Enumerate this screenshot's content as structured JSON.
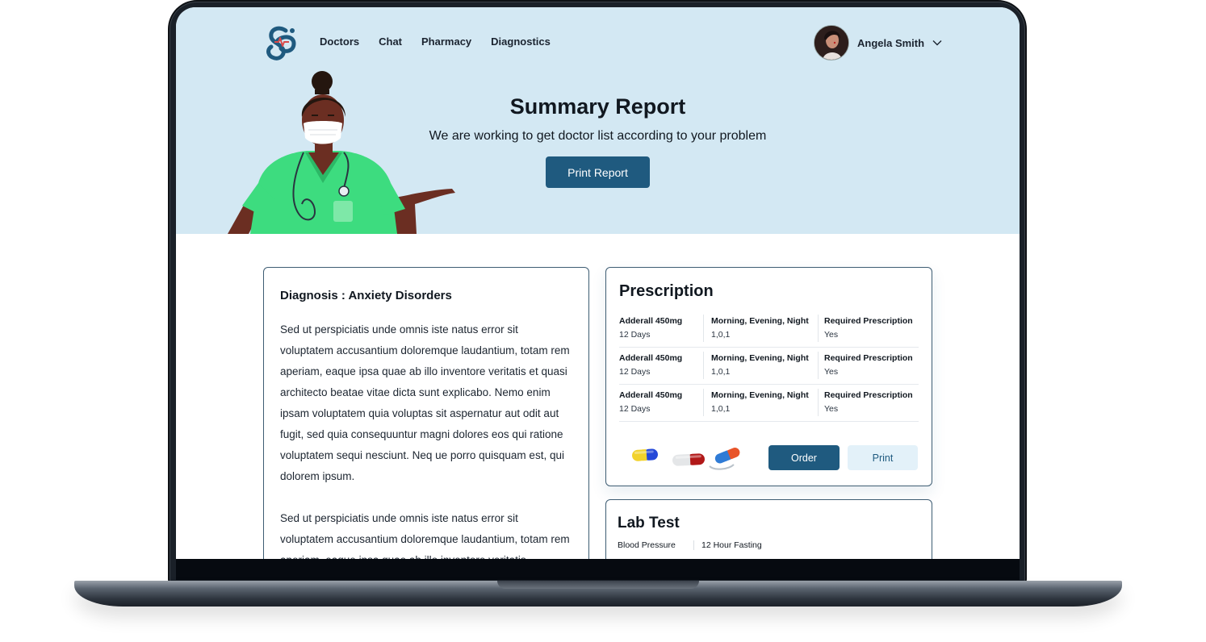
{
  "nav": {
    "links": [
      "Doctors",
      "Chat",
      "Pharmacy",
      "Diagnostics"
    ]
  },
  "user": {
    "name": "Angela Smith"
  },
  "hero": {
    "title": "Summary Report",
    "subtitle": "We are working to get doctor list according to your problem",
    "button_label": "Print Report"
  },
  "diagnosis": {
    "title": "Diagnosis : Anxiety Disorders",
    "paragraphs": [
      "Sed ut perspiciatis unde omnis iste natus error sit voluptatem accusantium doloremque laudantium, totam rem aperiam, eaque ipsa quae ab illo inventore veritatis et quasi architecto beatae vitae dicta sunt explicabo. Nemo enim ipsam voluptatem quia voluptas sit aspernatur aut odit aut fugit, sed quia consequuntur magni dolores eos qui ratione voluptatem sequi nesciunt. Neq ue porro quisquam est, qui dolorem ipsum.",
      "Sed ut perspiciatis unde omnis iste natus error sit voluptatem accusantium doloremque laudantium, totam rem aperiam, eaque ipsa quae ab illo inventore veritatis"
    ]
  },
  "prescription": {
    "title": "Prescription",
    "rows": [
      {
        "drug": "Adderall 450mg",
        "duration": "12 Days",
        "schedule": "Morning, Evening, Night",
        "dose": "1,0,1",
        "req_label": "Required Prescription",
        "req_value": "Yes"
      },
      {
        "drug": "Adderall 450mg",
        "duration": "12 Days",
        "schedule": "Morning, Evening, Night",
        "dose": "1,0,1",
        "req_label": "Required Prescription",
        "req_value": "Yes"
      },
      {
        "drug": "Adderall 450mg",
        "duration": "12 Days",
        "schedule": "Morning, Evening, Night",
        "dose": "1,0,1",
        "req_label": "Required Prescription",
        "req_value": "Yes"
      }
    ],
    "order_label": "Order",
    "print_label": "Print"
  },
  "lab_test": {
    "title": "Lab Test",
    "rows": [
      {
        "test": "Blood Pressure",
        "note": "12 Hour Fasting"
      }
    ]
  },
  "colors": {
    "hero_bg": "#d3e8f3",
    "primary": "#1f5a7f",
    "secondary_btn_bg": "#e3f1f9",
    "scrubs": "#3ddc7f",
    "card_border": "#3e5d73"
  },
  "icons": [
    "brand-logo-icon",
    "chevron-down-icon",
    "pill-capsules-icon"
  ]
}
